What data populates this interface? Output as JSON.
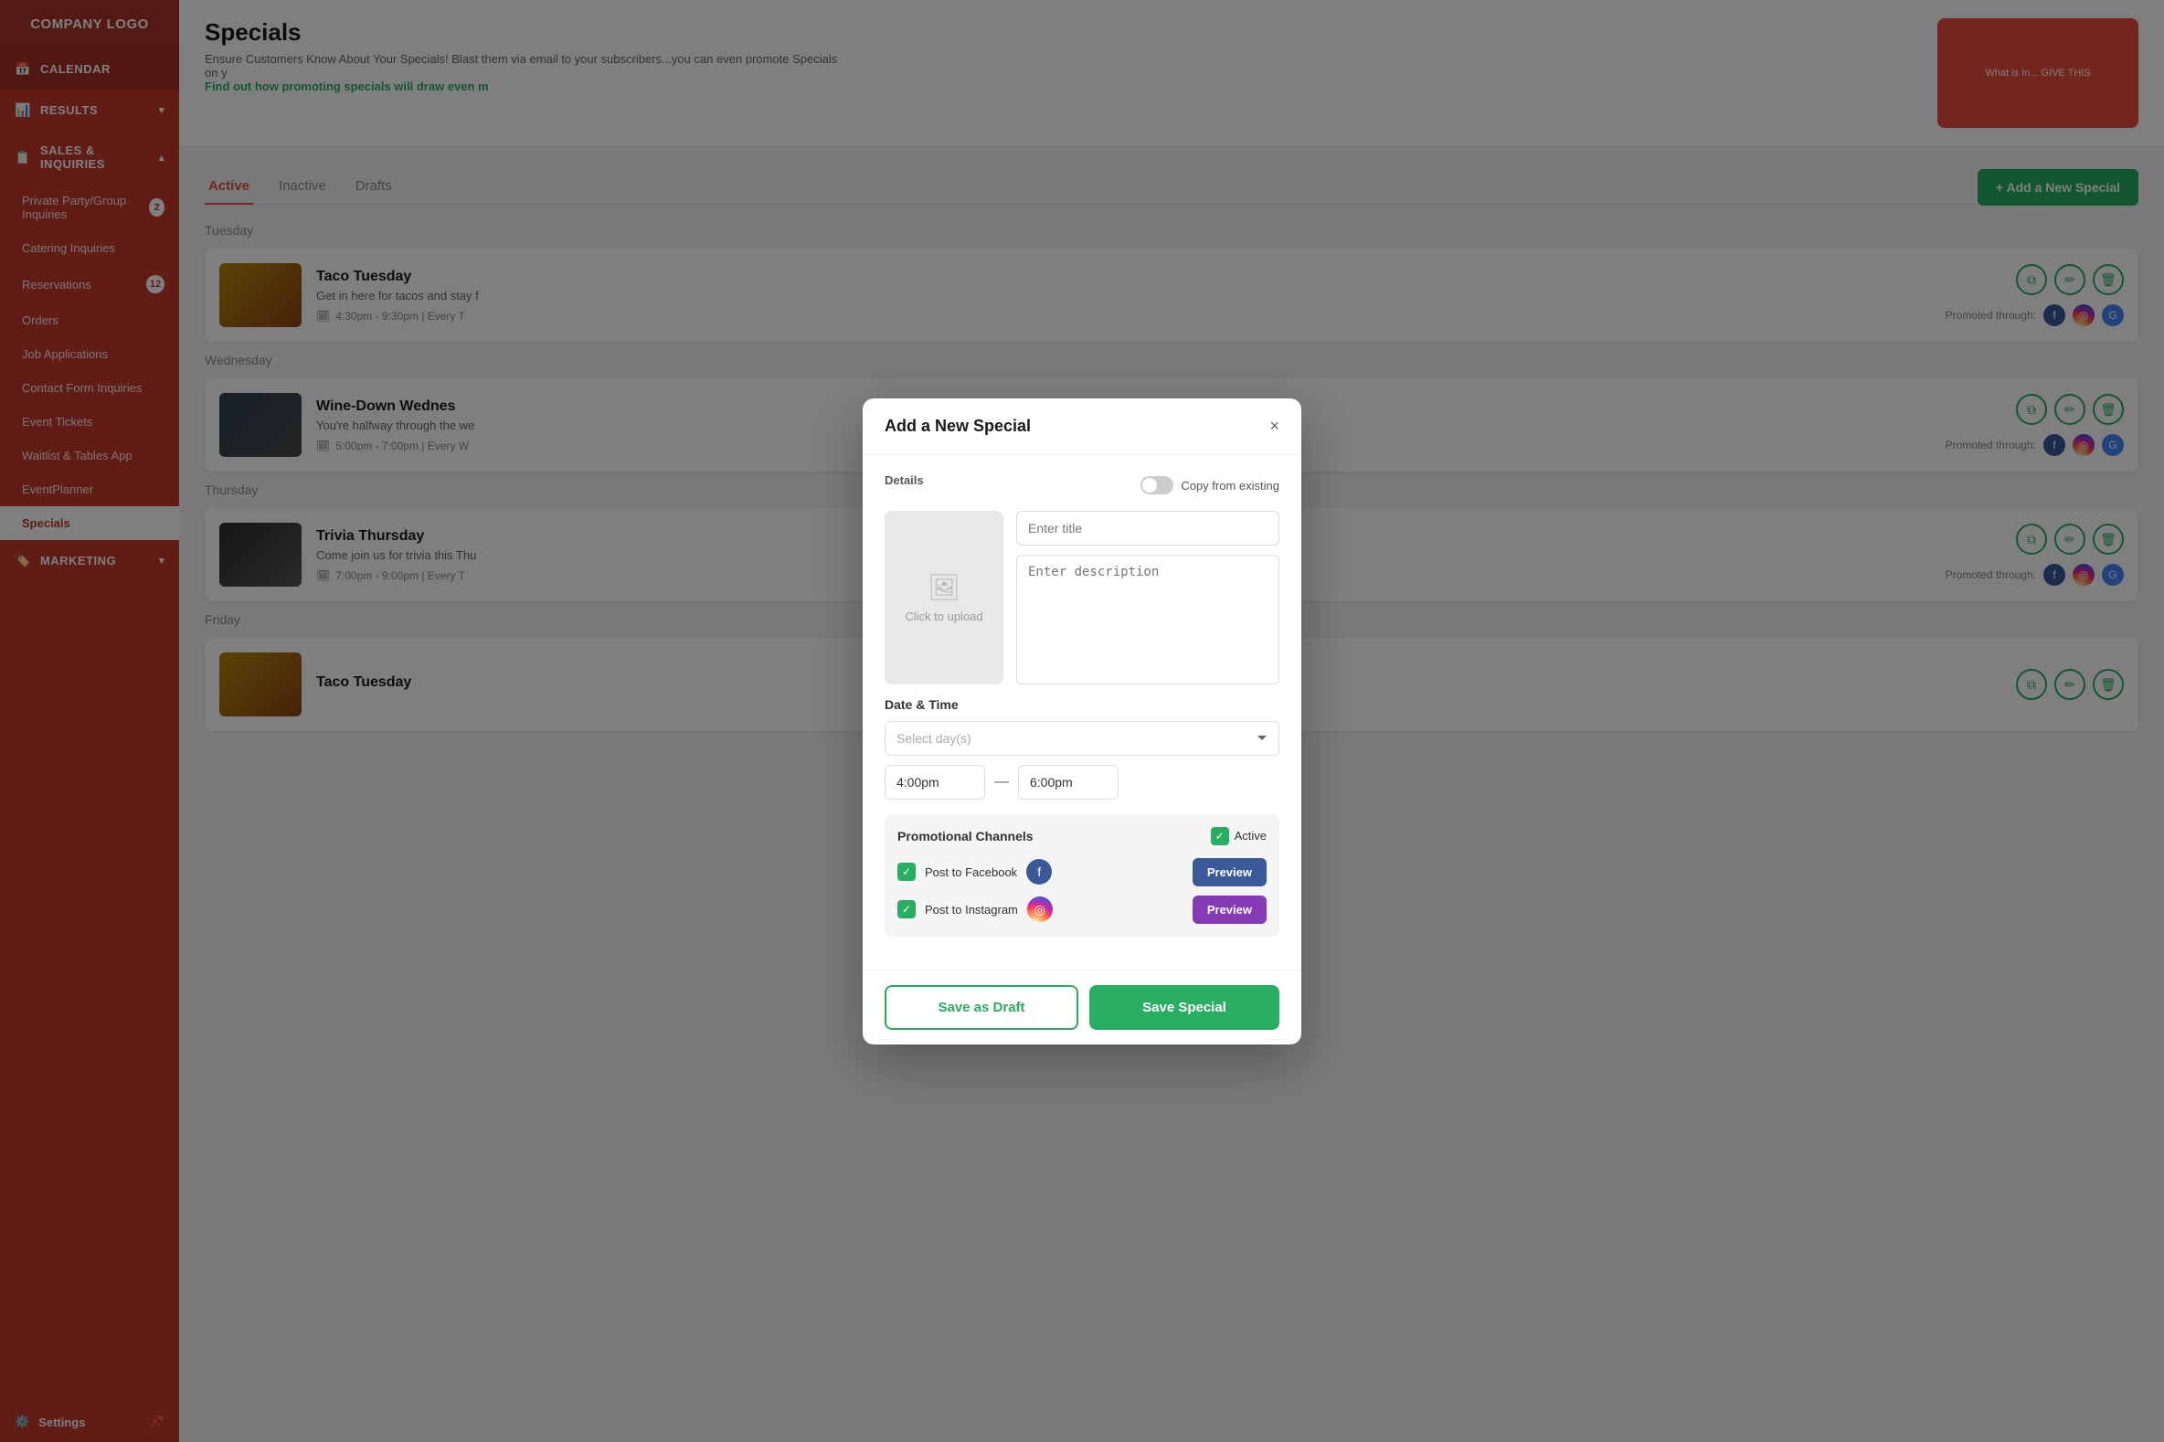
{
  "sidebar": {
    "logo": "COMPANY LOGO",
    "nav": [
      {
        "id": "calendar",
        "label": "CALENDAR",
        "icon": "📅",
        "type": "top"
      },
      {
        "id": "results",
        "label": "RESULTS",
        "icon": "📊",
        "type": "expandable",
        "expanded": false
      },
      {
        "id": "sales",
        "label": "SALES & INQUIRIES",
        "icon": "📋",
        "type": "expandable",
        "expanded": true
      }
    ],
    "sub_items": [
      {
        "id": "private-party",
        "label": "Private Party/Group Inquiries",
        "badge": "2"
      },
      {
        "id": "catering",
        "label": "Catering Inquiries",
        "badge": null
      },
      {
        "id": "reservations",
        "label": "Reservations",
        "badge": "12"
      },
      {
        "id": "orders",
        "label": "Orders",
        "badge": null
      },
      {
        "id": "job-applications",
        "label": "Job Applications",
        "badge": null
      },
      {
        "id": "contact-form",
        "label": "Contact Form Inquiries",
        "badge": null
      },
      {
        "id": "event-tickets",
        "label": "Event Tickets",
        "badge": null
      },
      {
        "id": "waitlist",
        "label": "Waitlist & Tables App",
        "badge": null
      },
      {
        "id": "event-planner",
        "label": "EventPlanner",
        "badge": null
      },
      {
        "id": "specials",
        "label": "Specials",
        "badge": null,
        "selected": true
      }
    ],
    "marketing": {
      "label": "MARKETING",
      "icon": "🏷️"
    },
    "footer": {
      "label": "Settings",
      "icon": "⚙️",
      "pin": "📌"
    }
  },
  "topbar": {
    "title": "Specials",
    "description": "Ensure Customers Know About Your Specials! Blast them via email to your subscribers...you can even promote Specials on y",
    "link_text": "Find out how promoting specials will draw even m",
    "ad_text": "What is In...\nGIVE THIS"
  },
  "tabs": [
    {
      "id": "active",
      "label": "Active",
      "active": true
    },
    {
      "id": "inactive",
      "label": "Inactive",
      "active": false
    },
    {
      "id": "drafts",
      "label": "Drafts",
      "active": false
    }
  ],
  "add_button": "+ Add a New Special",
  "specials": [
    {
      "day": "Tuesday",
      "name": "Taco Tuesday",
      "description": "Get in here for tacos and stay f",
      "time": "4:30pm - 9:30pm | Every T",
      "promoted": [
        "fb",
        "ig",
        "g"
      ]
    },
    {
      "day": "Wednesday",
      "name": "Wine-Down Wednes",
      "description": "You're halfway through the we",
      "time": "5:00pm - 7:00pm | Every W",
      "promoted": [
        "fb",
        "ig",
        "g"
      ]
    },
    {
      "day": "Thursday",
      "name": "Trivia Thursday",
      "description": "Come join us for trivia this Thu",
      "time": "7:00pm - 9:00pm | Every T",
      "promoted": [
        "fb",
        "ig",
        "g"
      ]
    },
    {
      "day": "Friday",
      "name": "Taco Tuesday",
      "description": "",
      "time": "",
      "promoted": []
    }
  ],
  "modal": {
    "title": "Add a New Special",
    "close_label": "×",
    "section_details": "Details",
    "copy_from_label": "Copy from existing",
    "upload_label": "Click to upload",
    "title_placeholder": "Enter title",
    "desc_placeholder": "Enter description",
    "datetime_label": "Date & Time",
    "day_select_placeholder": "Select day(s)",
    "time_start": "4:00pm",
    "time_end": "6:00pm",
    "promo_label": "Promotional Channels",
    "active_label": "Active",
    "fb_label": "Post to Facebook",
    "ig_label": "Post to Instagram",
    "fb_preview": "Preview",
    "ig_preview": "Preview",
    "save_draft": "Save as Draft",
    "save_special": "Save Special"
  },
  "colors": {
    "sidebar_bg": "#c0392b",
    "accent_green": "#27ae60",
    "accent_red": "#e74c3c",
    "active_tab": "#e74c3c"
  }
}
